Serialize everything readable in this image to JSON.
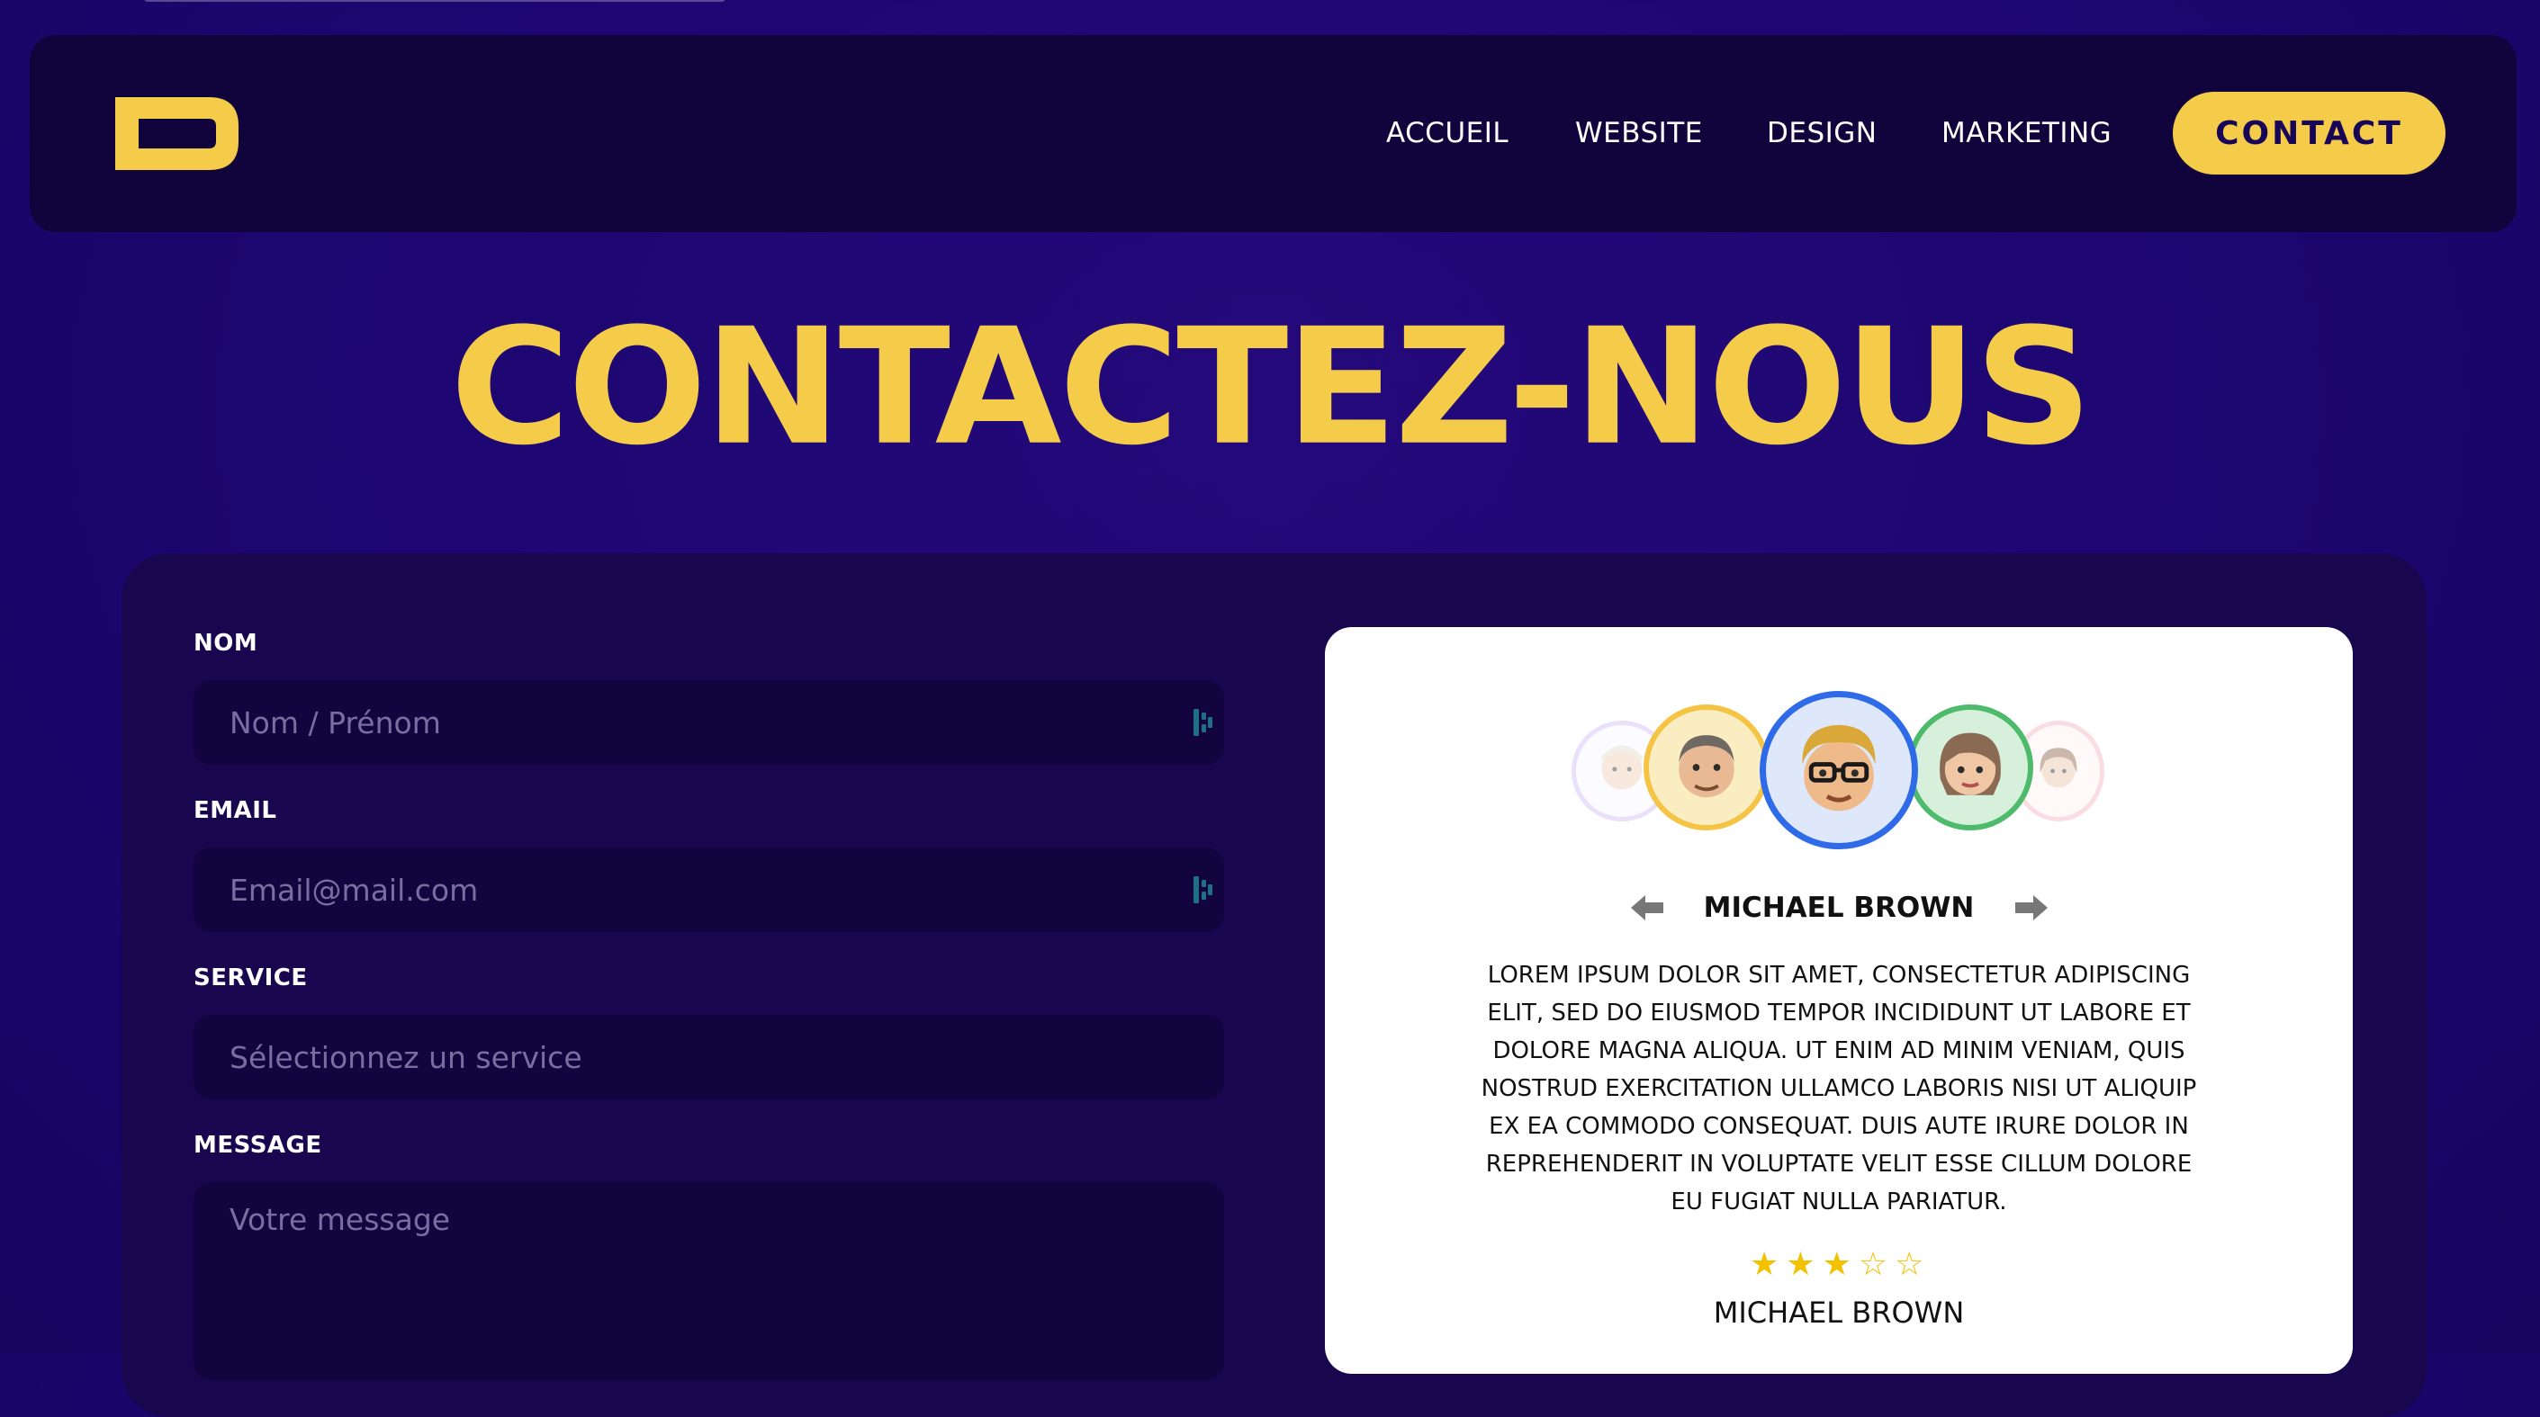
{
  "nav": {
    "links": [
      "ACCUEIL",
      "WEBSITE",
      "DESIGN",
      "MARKETING"
    ],
    "contact_button": "CONTACT"
  },
  "page": {
    "title": "CONTACTEZ-NOUS"
  },
  "form": {
    "name_label": "NOM",
    "name_placeholder": "Nom / Prénom",
    "email_label": "EMAIL",
    "email_placeholder": "Email@mail.com",
    "service_label": "SERVICE",
    "service_placeholder": "Sélectionnez un service",
    "message_label": "MESSAGE",
    "message_placeholder": "Votre message"
  },
  "testimonial": {
    "name": "MICHAEL BROWN",
    "text": "LOREM IPSUM DOLOR SIT AMET, CONSECTETUR ADIPISCING ELIT, SED DO EIUSMOD TEMPOR INCIDIDUNT UT LABORE ET DOLORE MAGNA ALIQUA. UT ENIM AD MINIM VENIAM, QUIS NOSTRUD EXERCITATION ULLAMCO LABORIS NISI UT ALIQUIP EX EA COMMODO CONSEQUAT. DUIS AUTE IRURE DOLOR IN REPREHENDERIT IN VOLUPTATE VELIT ESSE CILLUM DOLORE EU FUGIAT NULLA PARIATUR.",
    "rating": 3,
    "rating_max": 5,
    "footer_name": "MICHAEL BROWN",
    "avatar_ring_colors": [
      "#d9c8f5",
      "#f5c444",
      "#2f6be8",
      "#4dbb6b",
      "#f7c7cf"
    ]
  },
  "colors": {
    "accent": "#f4cc49",
    "background": "#1c0670",
    "nav_bg": "#11033c",
    "panel_bg": "#18064f",
    "field_bg": "#12043e"
  }
}
